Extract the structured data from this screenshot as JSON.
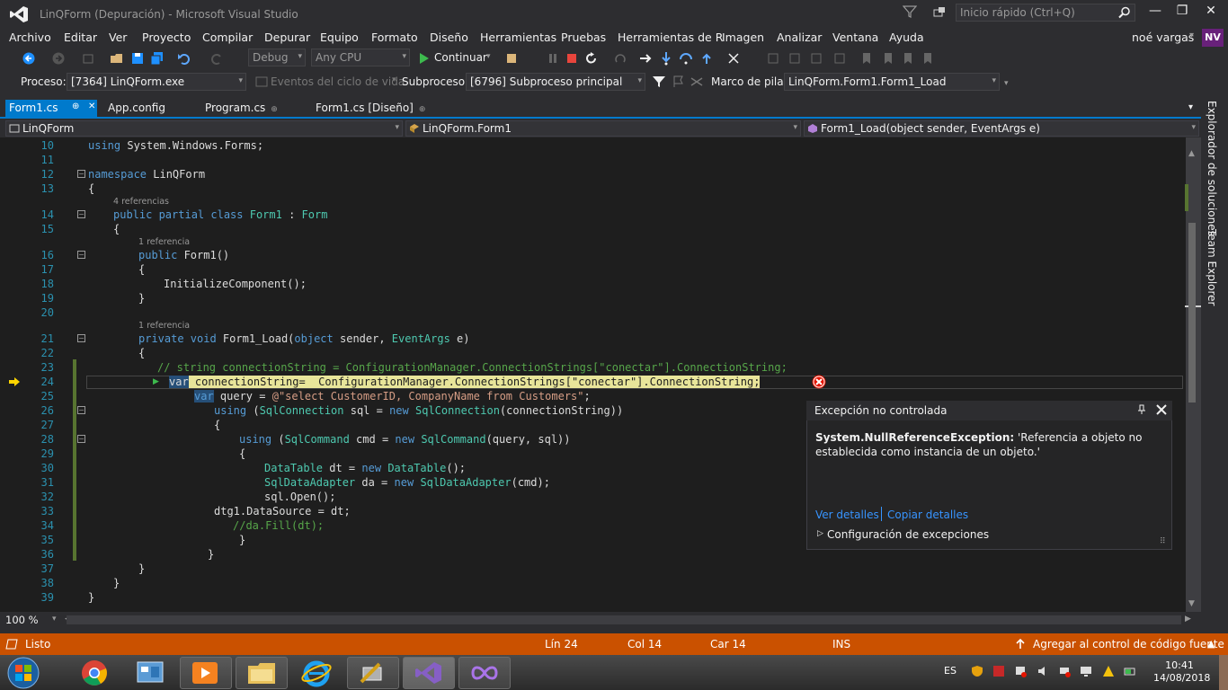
{
  "titlebar": {
    "title": "LinQForm (Depuración) - Microsoft Visual Studio",
    "quick_launch_placeholder": "Inicio rápido (Ctrl+Q)",
    "minimize": "—",
    "restore": "❐",
    "close": "✕"
  },
  "menu": [
    "Archivo",
    "Editar",
    "Ver",
    "Proyecto",
    "Compilar",
    "Depurar",
    "Equipo",
    "Formato",
    "Diseño",
    "Herramientas",
    "Pruebas",
    "Herramientas de R",
    "Imagen",
    "Analizar",
    "Ventana",
    "Ayuda"
  ],
  "user": {
    "name": "noé vargas",
    "initials": "NV"
  },
  "toolbar": {
    "config": "Debug",
    "platform": "Any CPU",
    "continue": "Continuar"
  },
  "debugbar": {
    "process_label": "Proceso:",
    "process_value": "[7364] LinQForm.exe",
    "lifecycle": "Eventos del ciclo de vida",
    "thread_label": "Subproceso:",
    "thread_value": "[6796] Subproceso principal",
    "stack_label": "Marco de pila:",
    "stack_value": "LinQForm.Form1.Form1_Load"
  },
  "tabs": [
    {
      "label": "Form1.cs",
      "pin": "⊕",
      "close": "✕"
    },
    {
      "label": "App.config"
    },
    {
      "label": "Program.cs",
      "pin": "⊕"
    },
    {
      "label": "Form1.cs [Diseño]",
      "pin": "⊕"
    }
  ],
  "tab_overflow": "▾",
  "navbar": {
    "project": "LinQForm",
    "class": "LinQForm.Form1",
    "member": "Form1_Load(object sender, EventArgs e)"
  },
  "code": {
    "l10": "10",
    "l11": "11",
    "l12": "12",
    "l13": "13",
    "l14": "14",
    "l15": "15",
    "l16": "16",
    "l17": "17",
    "l18": "18",
    "l19": "19",
    "l20": "20",
    "l21": "21",
    "l22": "22",
    "l23": "23",
    "l24": "24",
    "l25": "25",
    "l26": "26",
    "l27": "27",
    "l28": "28",
    "l29": "29",
    "l30": "30",
    "l31": "31",
    "l32": "32",
    "l33": "33",
    "l34": "34",
    "l35": "35",
    "l36": "36",
    "l37": "37",
    "l38": "38",
    "l39": "39",
    "lens_4": "4 referencias",
    "lens_1a": "1 referencia",
    "lens_1b": "1 referencia"
  },
  "exception": {
    "title": "Excepción no controlada",
    "type": "System.NullReferenceException:",
    "message": " 'Referencia a objeto no establecida como instancia de un objeto.'",
    "view_details": "Ver detalles",
    "copy_details": "Copiar detalles",
    "config": "Configuración de excepciones"
  },
  "zoom": "100 %",
  "sidetabs": {
    "solution": "Explorador de soluciones",
    "team": "Team Explorer"
  },
  "status": {
    "ready": "Listo",
    "line": "Lín 24",
    "col": "Col 14",
    "char": "Car 14",
    "ins": "INS",
    "source_control": "Agregar al control de código fuente"
  },
  "taskbar": {
    "lang": "ES",
    "time": "10:41",
    "date": "14/08/2018"
  },
  "colors": {
    "accent": "#007acc",
    "status_bar": "#ca5100",
    "error": "#e51400"
  }
}
